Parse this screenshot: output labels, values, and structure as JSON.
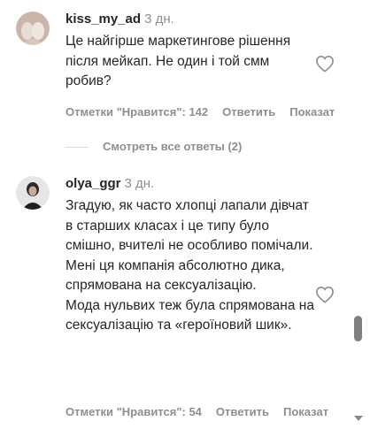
{
  "comments": [
    {
      "username": "kiss_my_ad",
      "time": "3 дн.",
      "text": [
        "Це найгірше маркетингове рішення після мейкап. Не один і той смм робив?"
      ],
      "likes_label": "Отметки \"Нравится\": 142",
      "reply_label": "Ответить",
      "show_label": "Показат"
    },
    {
      "username": "olya_ggr",
      "time": "3 дн.",
      "text": [
        "Згадую, як часто хлопці лапали дівчат в старших класах і це типу було смішно, вчителі не особливо помічали.",
        "Мені ця компанія абсолютно дика, спрямована на сексуалізацію.",
        "Мода нульвих теж була спрямована на сексуалізацію та «героїновий шик»."
      ],
      "likes_label": "Отметки \"Нравится\": 54",
      "reply_label": "Ответить",
      "show_label": "Показат"
    }
  ],
  "view_replies": "Смотреть все ответы (2)",
  "icons": {
    "like": "heart-icon",
    "scroll_down": "chevron-down-icon"
  },
  "colors": {
    "text": "#262626",
    "secondary": "#8e8e8e"
  }
}
